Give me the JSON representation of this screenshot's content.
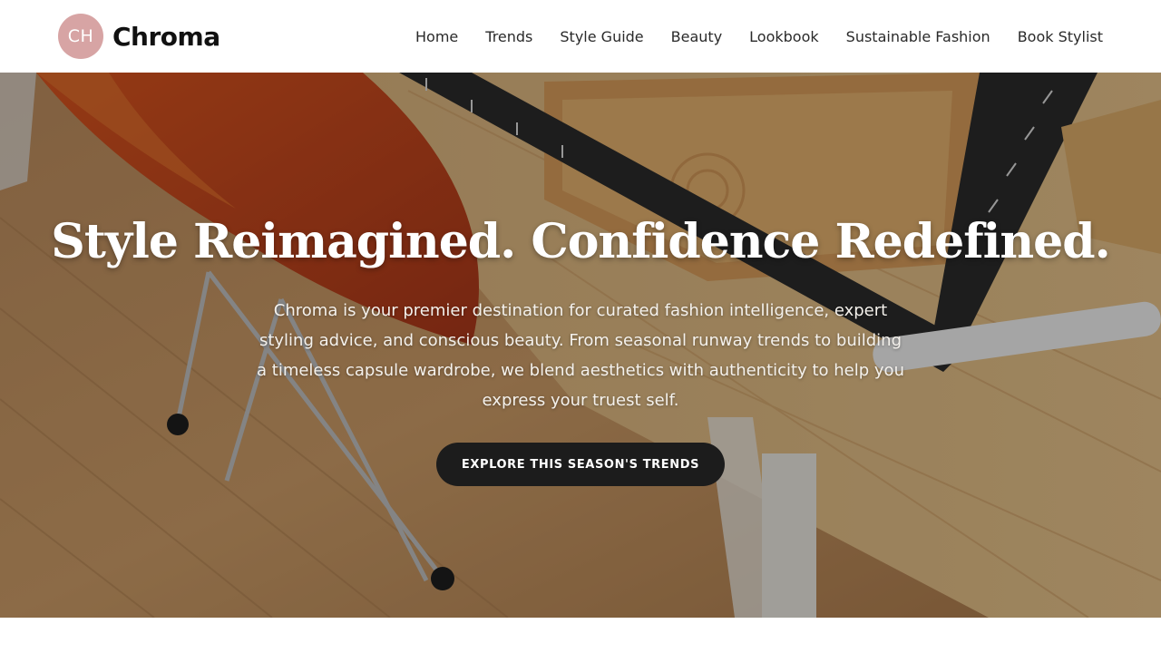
{
  "brand": {
    "monogram": "CH",
    "name": "Chroma",
    "monogram_color": "#d7a4a4"
  },
  "nav": {
    "items": [
      {
        "label": "Home"
      },
      {
        "label": "Trends"
      },
      {
        "label": "Style Guide"
      },
      {
        "label": "Beauty"
      },
      {
        "label": "Lookbook"
      },
      {
        "label": "Sustainable Fashion"
      },
      {
        "label": "Book Stylist"
      }
    ]
  },
  "hero": {
    "title": "Style Reimagined. Confidence Redefined.",
    "description": "Chroma is your premier destination for curated fashion intelligence, expert styling advice, and conscious beauty. From seasonal runway trends to building a timeless capsule wardrobe, we blend aesthetics with authenticity to help you express your truest self.",
    "cta_label": "EXPLORE THIS SEASON'S TRENDS",
    "cta_color": "#1c1c1c"
  }
}
